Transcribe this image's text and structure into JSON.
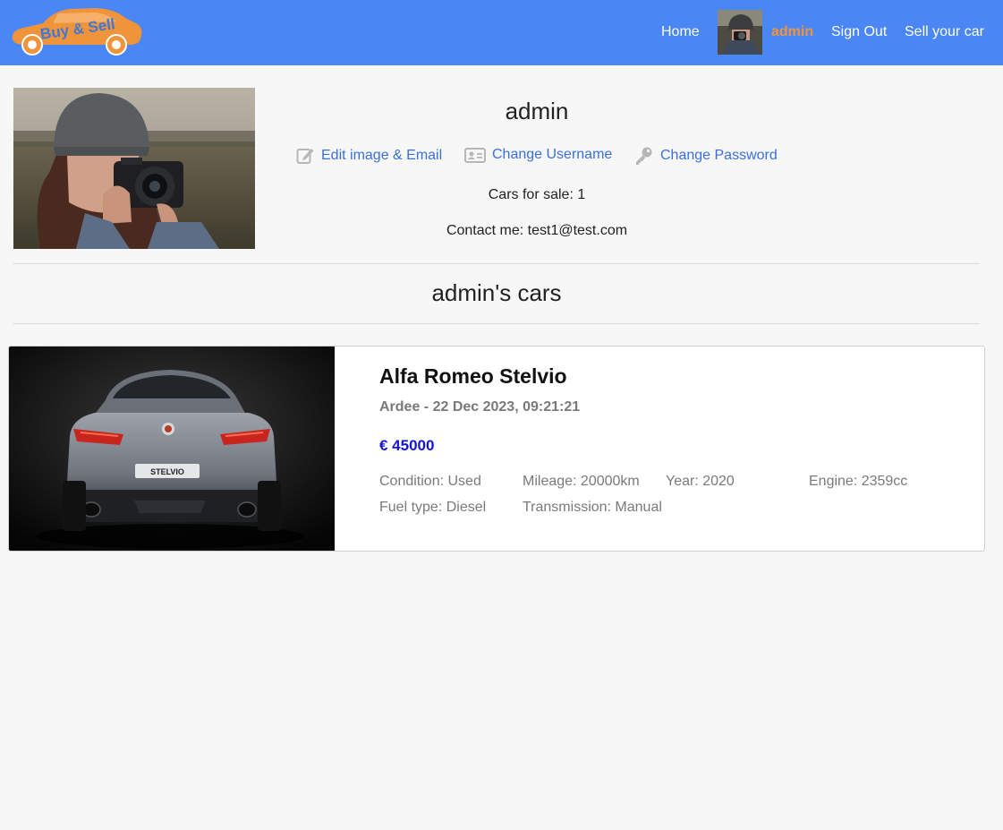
{
  "nav": {
    "logo_text": "Buy & Sell",
    "home": "Home",
    "username": "admin",
    "sign_out": "Sign Out",
    "sell": "Sell your car"
  },
  "profile": {
    "name": "admin",
    "actions": {
      "edit": "Edit image & Email",
      "username": "Change Username",
      "password": "Change Password"
    },
    "cars_for_sale": "Cars for sale: 1",
    "contact_label": "Contact me:",
    "contact_email": "test1@test.com"
  },
  "cars_section": {
    "title": "admin's cars"
  },
  "cars": [
    {
      "title": "Alfa Romeo Stelvio",
      "meta": "Ardee - 22 Dec 2023, 09:21:21",
      "price": "€ 45000",
      "condition": "Condition: Used",
      "mileage": "Mileage: 20000km",
      "year": "Year: 2020",
      "engine": "Engine: 2359cc",
      "fuel": "Fuel type: Diesel",
      "transmission": "Transmission: Manual",
      "badge": "STELVIO"
    }
  ],
  "colors": {
    "navbar": "#4a86f4",
    "accent_orange": "#f0943c",
    "link_blue": "#3a6fe0",
    "price_blue": "#1515d6"
  },
  "icons": {
    "edit": "edit-icon",
    "username": "id-card-icon",
    "password": "key-icon"
  }
}
